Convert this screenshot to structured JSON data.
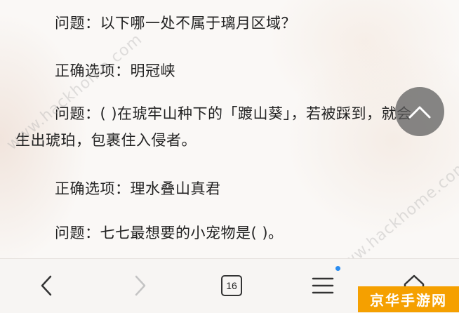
{
  "content": {
    "question1": "问题：以下哪一处不属于璃月区域？",
    "answer1": "正确选项：明冠峡",
    "question2": "问题：( )在琥牢山种下的「踱山葵」，若被踩到，就会生出琥珀，包裹住入侵者。",
    "answer2": "正确选项：理水叠山真君",
    "question3": "问题：七七最想要的小宠物是( )。"
  },
  "watermark": {
    "text1": "www.hackhome.com",
    "text2": "www.hackhome.com"
  },
  "toolbar": {
    "tab_count": "16",
    "menu_has_notification": true,
    "notification_color": "#2a8cf0"
  },
  "logo": {
    "text": "京华手游网",
    "color": "#f5a000"
  },
  "icons": {
    "scroll_top": "chevron-up-icon",
    "back": "chevron-left-icon",
    "forward": "chevron-right-icon",
    "menu": "hamburger-menu-icon",
    "home": "home-icon"
  }
}
